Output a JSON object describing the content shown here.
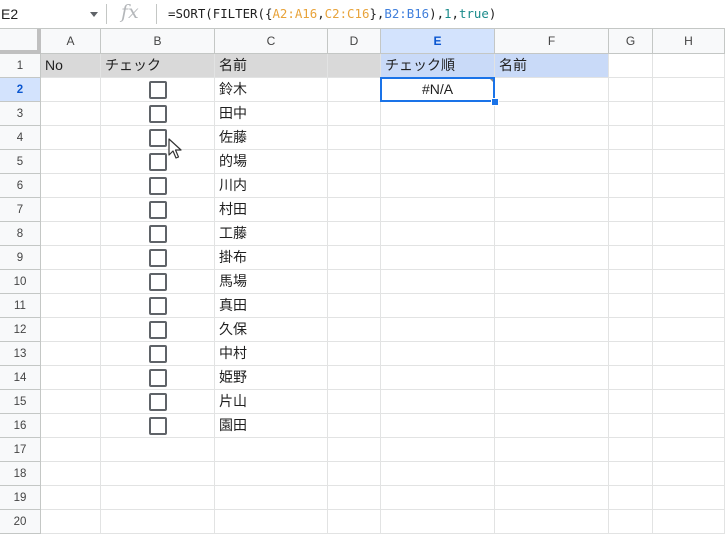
{
  "formula_bar": {
    "name_box": "E2",
    "fx_icon": "fx",
    "formula_parts": [
      {
        "text": "=SORT(FILTER({",
        "color": "default"
      },
      {
        "text": "A2:A16",
        "color": "orange"
      },
      {
        "text": ",",
        "color": "default"
      },
      {
        "text": "C2:C16",
        "color": "orange"
      },
      {
        "text": "},",
        "color": "default"
      },
      {
        "text": "B2:B16",
        "color": "blue"
      },
      {
        "text": "),",
        "color": "default"
      },
      {
        "text": "1",
        "color": "teal"
      },
      {
        "text": ",",
        "color": "default"
      },
      {
        "text": "true",
        "color": "teal"
      },
      {
        "text": ")",
        "color": "default"
      }
    ]
  },
  "columns": [
    "A",
    "B",
    "C",
    "D",
    "E",
    "F",
    "G",
    "H"
  ],
  "rows": [
    "1",
    "2",
    "3",
    "4",
    "5",
    "6",
    "7",
    "8",
    "9",
    "10",
    "11",
    "12",
    "13",
    "14",
    "15",
    "16",
    "17",
    "18",
    "19",
    "20"
  ],
  "selected_cell": {
    "column": "E",
    "row": "2"
  },
  "headers": {
    "A1": "No",
    "B1": "チェック",
    "C1": "名前",
    "E1": "チェック順",
    "F1": "名前"
  },
  "names": [
    "鈴木",
    "田中",
    "佐藤",
    "的場",
    "川内",
    "村田",
    "工藤",
    "掛布",
    "馬場",
    "真田",
    "久保",
    "中村",
    "姫野",
    "片山",
    "園田"
  ],
  "checkbox_states": [
    false,
    false,
    false,
    false,
    false,
    false,
    false,
    false,
    false,
    false,
    false,
    false,
    false,
    false,
    false
  ],
  "E2_value": "#N/A",
  "colors": {
    "header_gray": "#d9d9d9",
    "header_blue": "#c9daf8",
    "selection": "#1a73e8",
    "formula_orange": "#e8a33a",
    "formula_blue": "#3f7fdd"
  }
}
